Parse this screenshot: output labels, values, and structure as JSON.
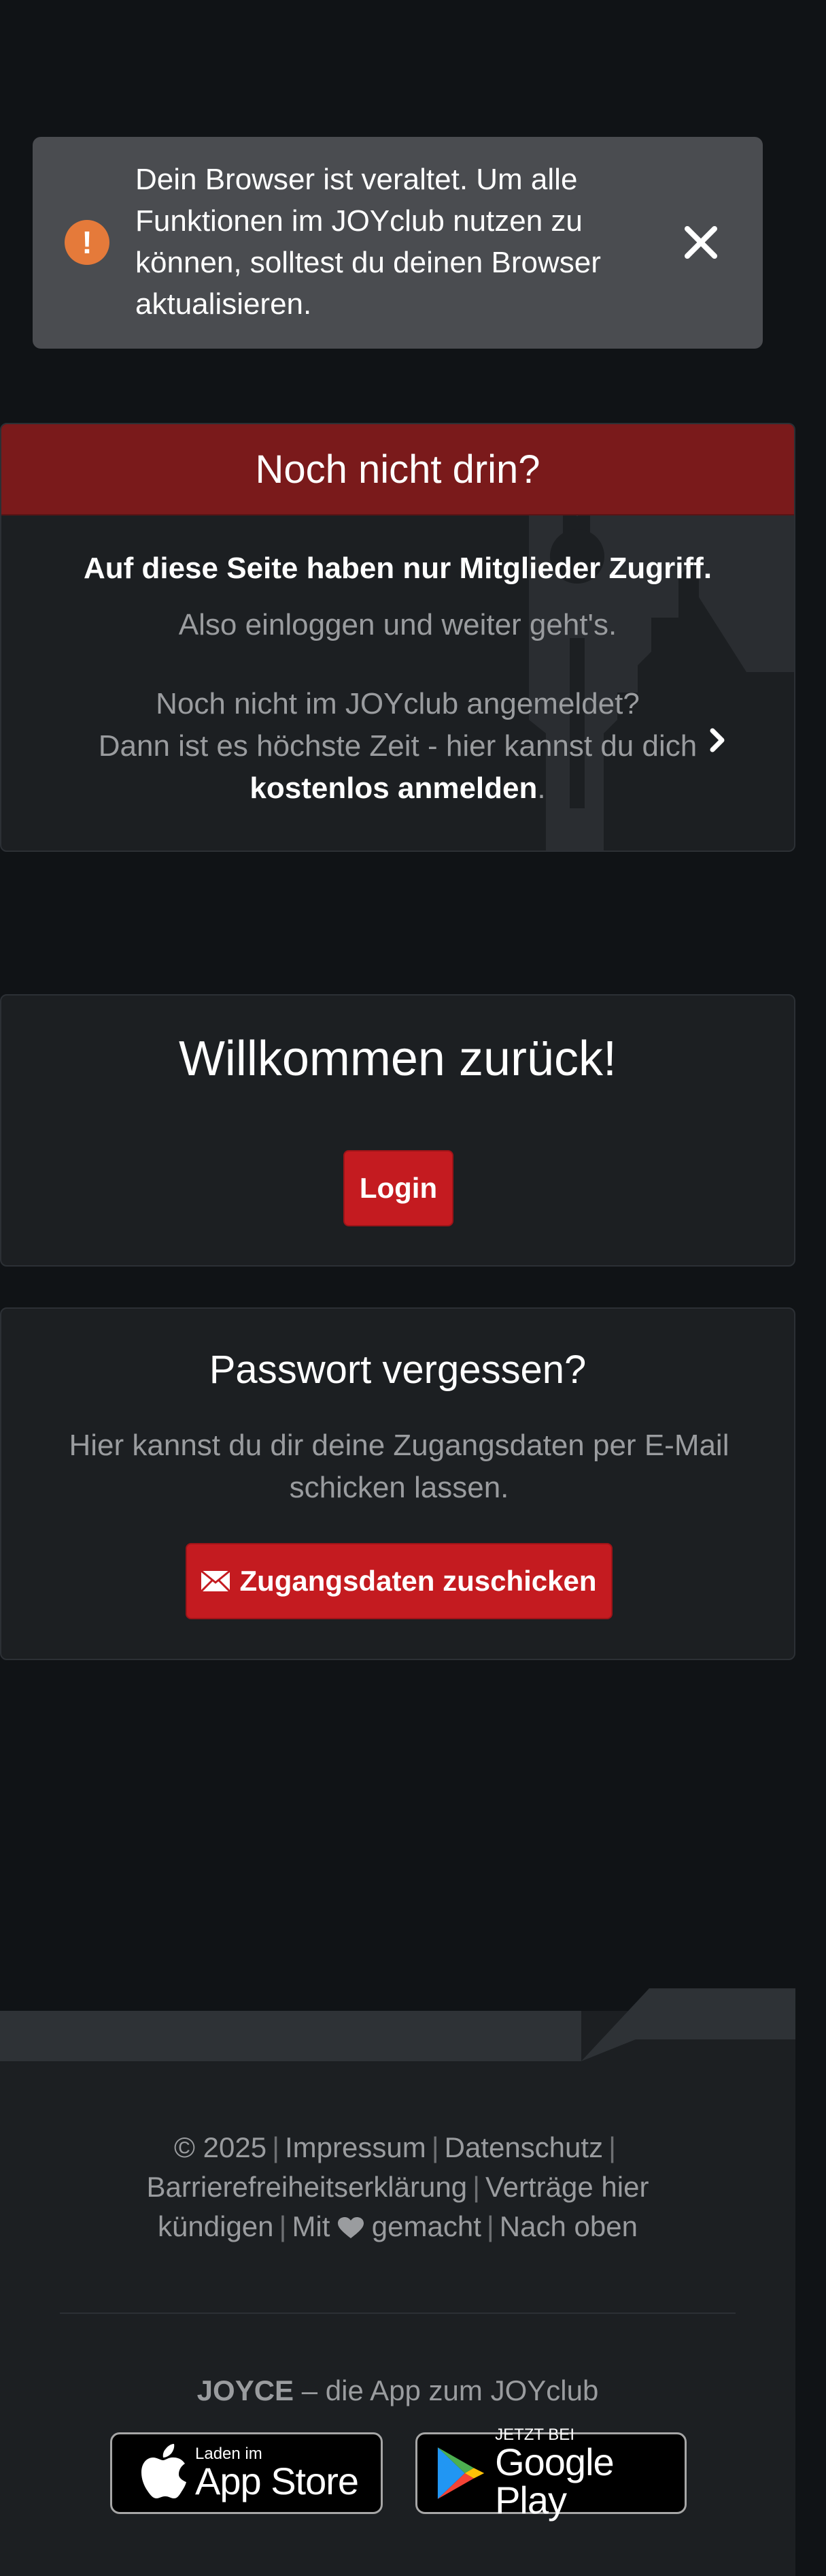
{
  "alert": {
    "text": "Dein Browser ist veraltet. Um alle Funktionen im JOYclub nutzen zu können, solltest du deinen Browser aktualisieren.",
    "icon": "exclamation-icon",
    "close_icon": "close-icon",
    "color": "#e57a3a"
  },
  "members_only": {
    "title": "Noch nicht drin?",
    "bold_text": "Auf diese Seite haben nur Mitglieder Zugriff.",
    "subtext": "Also einloggen und weiter geht's.",
    "signup_line1": "Noch nicht im JOYclub angemeldet?",
    "signup_line2": "Dann ist es höchste Zeit - hier kannst du dich",
    "signup_link": "kostenlos anmelden",
    "signup_end": ".",
    "header_color": "#7a1a1b"
  },
  "login": {
    "title": "Willkommen zurück!",
    "button_label": "Login"
  },
  "password": {
    "title": "Passwort vergessen?",
    "text": "Hier kannst du dir deine Zugangsdaten per E-Mail schicken lassen.",
    "button_label": "Zugangsdaten zuschicken"
  },
  "footer": {
    "copyright": "© 2025",
    "links": [
      "Impressum",
      "Datenschutz",
      "Barrierefreiheitserklärung",
      "Verträge hier kündigen"
    ],
    "made_with_prefix": "Mit",
    "made_with_suffix": "gemacht",
    "back_to_top": "Nach oben",
    "app_brand": "JOYCE",
    "app_text": "– die App zum JOYclub",
    "apple_small": "Laden im",
    "apple_big": "App Store",
    "google_small": "JETZT BEI",
    "google_big": "Google Play"
  },
  "colors": {
    "background": "#101316",
    "panel": "#1c1f22",
    "button": "#c41b20"
  }
}
